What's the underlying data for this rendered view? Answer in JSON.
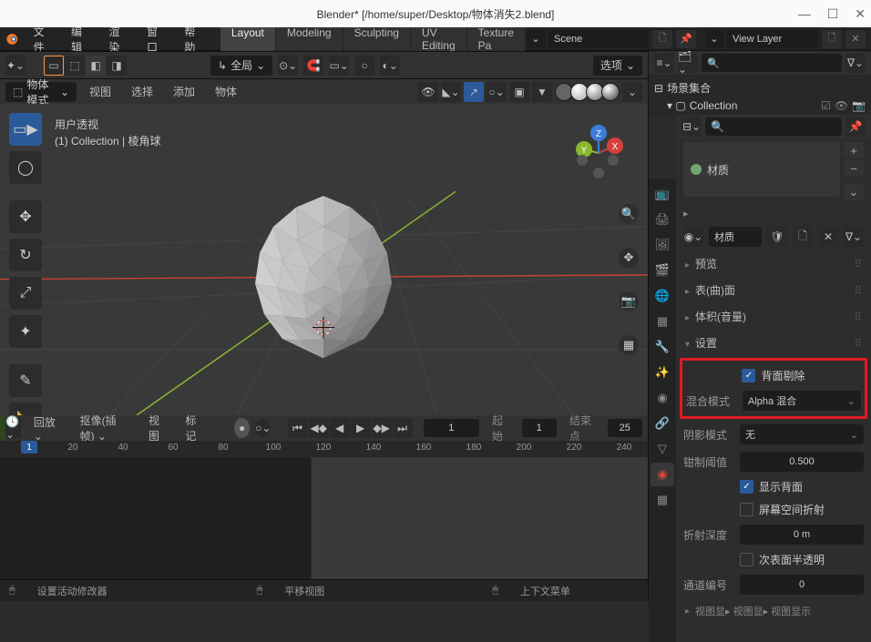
{
  "window": {
    "title": "Blender* [/home/super/Desktop/物体消失2.blend]"
  },
  "menu": [
    "文件",
    "编辑",
    "渲染",
    "窗口",
    "帮助"
  ],
  "workspaces": {
    "active": "Layout",
    "tabs": [
      "Layout",
      "Modeling",
      "Sculpting",
      "UV Editing",
      "Texture Pa"
    ]
  },
  "scene_name": "Scene",
  "view_layer": "View Layer",
  "viewport": {
    "options_label": "选项",
    "mode": "物体模式",
    "hdr_items": [
      "视图",
      "选择",
      "添加",
      "物体"
    ],
    "global_label": "全局",
    "overlay_title": "用户透视",
    "overlay_sub": "(1) Collection | 棱角球"
  },
  "outliner": {
    "root": "场景集合",
    "collection": "Collection"
  },
  "timeline": {
    "play_label": "回放",
    "keying_label": "抠像(插帧)",
    "items": [
      "视图",
      "标记"
    ],
    "current": 1,
    "start_label": "起始",
    "start": 1,
    "end_label": "结束点",
    "end": 25,
    "ruler": [
      1,
      20,
      40,
      60,
      80,
      100,
      120,
      140,
      160,
      180,
      200,
      220,
      240
    ]
  },
  "statusbar": {
    "left": "设置活动修改器",
    "mid": "平移视图",
    "right": "上下文菜单"
  },
  "properties": {
    "material_name": "材质",
    "material_slot": "材质",
    "sections": {
      "preview": "预览",
      "surface": "表(曲)面",
      "volume": "体积(音量)",
      "settings": "设置"
    },
    "backface_cull_label": "背面剔除",
    "blend_mode_label": "混合模式",
    "blend_mode_value": "Alpha 混合",
    "shadow_mode_label": "阴影模式",
    "shadow_mode_value": "无",
    "clip_threshold_label": "钳制阈值",
    "clip_threshold_value": "0.500",
    "show_backface_label": "显示背面",
    "ssr_label": "屏幕空间折射",
    "refraction_depth_label": "折射深度",
    "refraction_depth_value": "0 m",
    "subsurface_translucency_label": "次表面半透明",
    "pass_index_label": "通道编号",
    "pass_index_value": "0",
    "footer": "视图显▸ 视图显▸ 视图显示"
  }
}
